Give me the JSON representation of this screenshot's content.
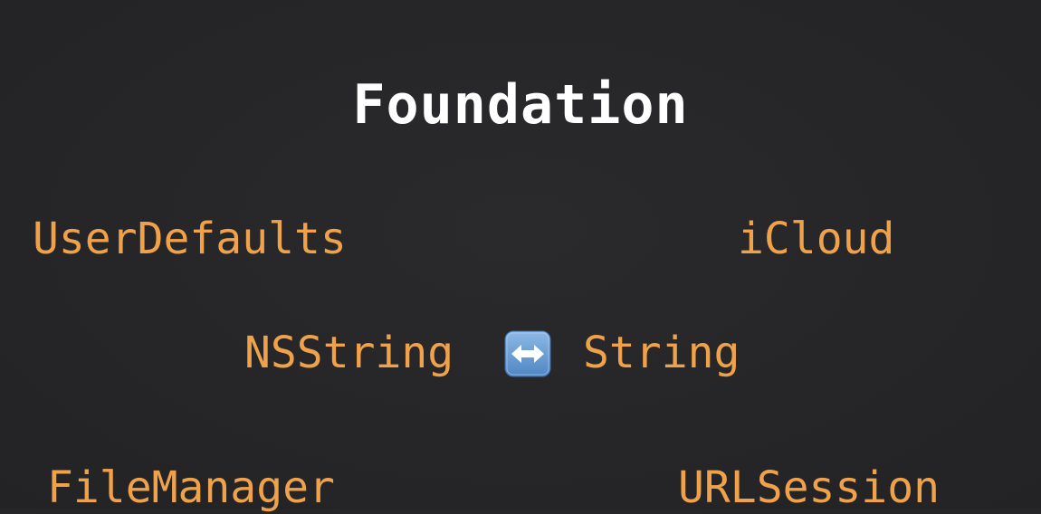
{
  "slide": {
    "title": "Foundation",
    "terms": {
      "user_defaults": "UserDefaults",
      "icloud": "iCloud",
      "nsstring": "NSString",
      "string": "String",
      "file_manager": "FileManager",
      "url_session": "URLSession"
    },
    "bridge_icon": "left-right-arrow-icon",
    "colors": {
      "background": "#262628",
      "title": "#ffffff",
      "term": "#f0a24a",
      "icon_bg": "#6fa3d8"
    }
  }
}
